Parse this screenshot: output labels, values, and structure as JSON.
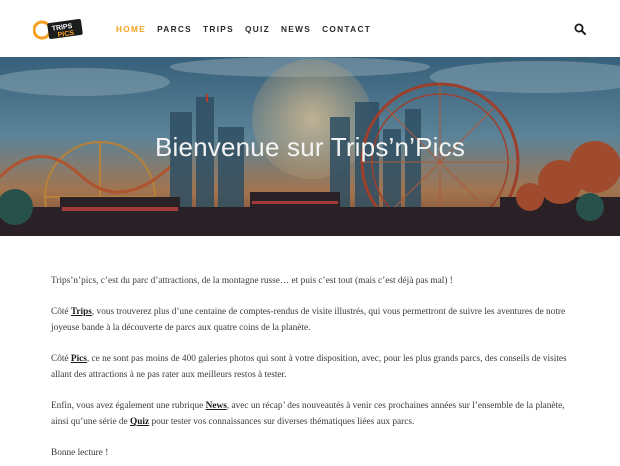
{
  "header": {
    "logo_alt": "Trips'n'Pics",
    "nav": [
      {
        "label": "HOME",
        "active": true
      },
      {
        "label": "PARCS",
        "active": false
      },
      {
        "label": "TRIPS",
        "active": false
      },
      {
        "label": "QUIZ",
        "active": false
      },
      {
        "label": "NEWS",
        "active": false
      },
      {
        "label": "CONTACT",
        "active": false
      }
    ],
    "search_icon": "search-icon",
    "accent_color": "#f5a020"
  },
  "hero": {
    "title": "Bienvenue sur Trips’n’Pics"
  },
  "content": {
    "p1": "Trips’n’pics, c’est du parc d’attractions, de la montagne russe… et puis c’est tout (mais c’est déjà pas mal) !",
    "p2_before": "Côté ",
    "p2_link": "Trips",
    "p2_after": ", vous trouverez plus d’une centaine de comptes-rendus de visite illustrés, qui vous permettront de suivre les aventures de notre joyeuse bande à la découverte de parcs aux quatre coins de la planète.",
    "p3_before": "Côté ",
    "p3_link": "Pics",
    "p3_after": ", ce ne sont pas moins de 400 galeries photos qui sont à votre disposition, avec, pour les plus grands parcs, des conseils de visites allant des attractions à ne pas rater aux meilleurs restos à tester.",
    "p4_before": "Enfin, vous avez également une rubrique ",
    "p4_link1": "News",
    "p4_mid": ", avec un récap’ des nouveautés à venir ces prochaines années sur l’ensemble de la planète, ainsi qu’une série de ",
    "p4_link2": "Quiz",
    "p4_after": " pour tester vos connaissances sur diverses thématiques liées aux parcs.",
    "p5": "Bonne lecture !"
  }
}
